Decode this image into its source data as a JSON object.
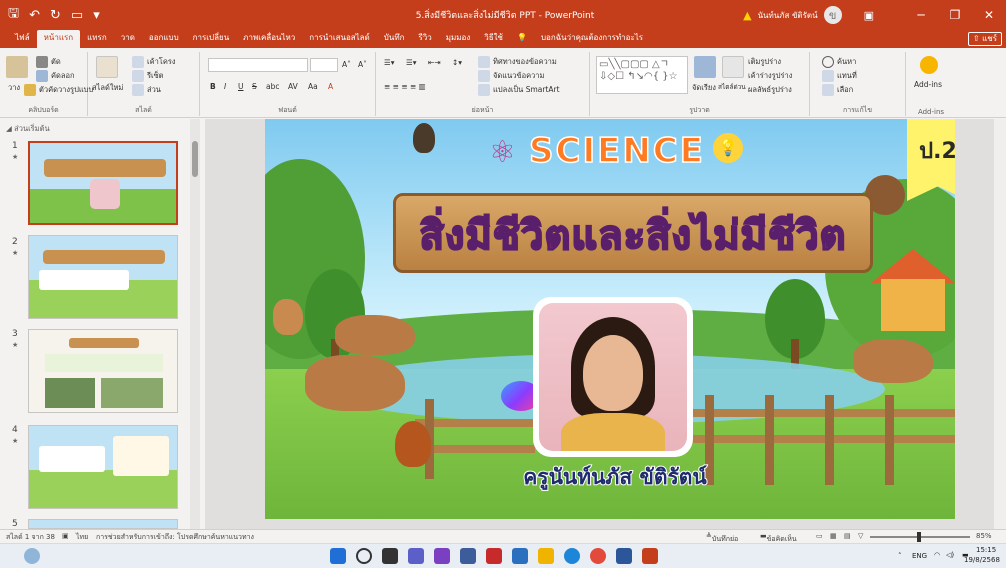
{
  "app": {
    "title": "5.สิ่งมีชีวิตและสิ่งไม่มีชีวิต PPT  -  PowerPoint",
    "user_name": "นันท์นภัส ขัติรัตน์",
    "user_initial": "ข",
    "warning_icon": "warning-icon",
    "accent_color": "#c43e1c"
  },
  "ribbon_tabs": {
    "file": "ไฟล์",
    "home": "หน้าแรก",
    "insert": "แทรก",
    "draw": "วาด",
    "design": "ออกแบบ",
    "transitions": "การเปลี่ยน",
    "animations": "ภาพเคลื่อนไหว",
    "slideshow": "การนำเสนอสไลด์",
    "record": "บันทึก",
    "review": "รีวิว",
    "view": "มุมมอง",
    "help": "วิธีใช้",
    "tell_me": "บอกฉันว่าคุณต้องการทำอะไร",
    "share": "แชร์"
  },
  "ribbon": {
    "clipboard": {
      "paste": "วาง",
      "cut": "ตัด",
      "copy": "คัดลอก",
      "format_painter": "ตัวคัดวางรูปแบบ",
      "label": "คลิปบอร์ด"
    },
    "slides": {
      "new_slide": "สไลด์ใหม่",
      "layout": "เค้าโครง",
      "reset": "รีเซ็ต",
      "section": "ส่วน",
      "label": "สไลด์"
    },
    "font": {
      "label": "ฟอนต์",
      "size": "",
      "bold": "B",
      "italic": "I",
      "underline": "U",
      "strike": "S",
      "shadow": "abc",
      "spacing": "AV",
      "case": "Aa",
      "color": "A"
    },
    "paragraph": {
      "label": "ย่อหน้า",
      "text_direction": "ทิศทางของข้อความ",
      "align_text": "จัดแนวข้อความ",
      "smartart": "แปลงเป็น SmartArt"
    },
    "drawing": {
      "label": "รูปวาด",
      "arrange": "จัดเรียง",
      "quick_styles": "สไตล์ด่วน",
      "shape_fill": "เติมรูปร่าง",
      "shape_outline": "เค้าร่างรูปร่าง",
      "shape_effects": "ผลลัพธ์รูปร่าง"
    },
    "editing": {
      "label": "การแก้ไข",
      "find": "ค้นหา",
      "replace": "แทนที่",
      "select": "เลือก"
    },
    "addins": {
      "label": "Add-ins",
      "button": "Add-ins"
    }
  },
  "panel": {
    "section_header": "ส่วนเริ่มต้น",
    "slides": [
      {
        "num": "1"
      },
      {
        "num": "2"
      },
      {
        "num": "3"
      },
      {
        "num": "4"
      },
      {
        "num": "5"
      }
    ]
  },
  "slide": {
    "science": "SCIENCE",
    "grade": "ป.2",
    "title": "สิ่งมีชีวิตและสิ่งไม่มีชีวิต",
    "teacher": "ครูนันท์นภัส ขัติรัตน์"
  },
  "status": {
    "slide_count": "สไลด์ 1 จาก 38",
    "language": "ไทย",
    "accessibility": "การช่วยสำหรับการเข้าถึง: โปรดศึกษาค้นหาแนวทาง",
    "notes": "บันทึกย่อ",
    "comments": "ข้อคิดเห็น",
    "zoom": "85%"
  },
  "taskbar": {
    "lang": "ENG",
    "time": "15:15",
    "date": "19/8/2568"
  }
}
